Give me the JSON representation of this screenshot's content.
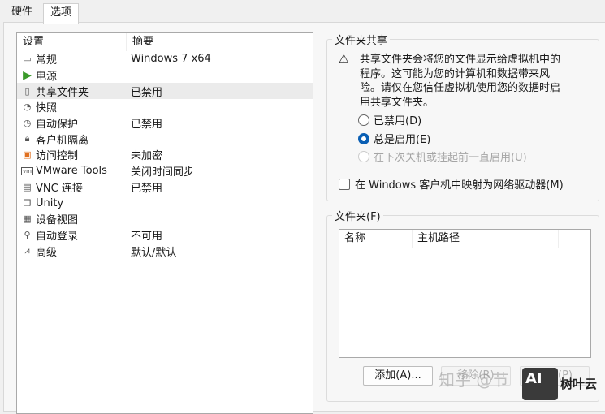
{
  "tabs": [
    {
      "label": "硬件"
    },
    {
      "label": "选项"
    }
  ],
  "settings": {
    "headers": [
      "设置",
      "摘要"
    ],
    "rows": [
      {
        "icon": "monitor-icon",
        "name": "常规",
        "summary": "Windows 7 x64"
      },
      {
        "icon": "play-icon",
        "name": "电源",
        "summary": ""
      },
      {
        "icon": "shared-folder-icon",
        "name": "共享文件夹",
        "summary": "已禁用"
      },
      {
        "icon": "snapshot-icon",
        "name": "快照",
        "summary": ""
      },
      {
        "icon": "clock-icon",
        "name": "自动保护",
        "summary": "已禁用"
      },
      {
        "icon": "lock-icon",
        "name": "客户机隔离",
        "summary": ""
      },
      {
        "icon": "access-control-icon",
        "name": "访问控制",
        "summary": "未加密"
      },
      {
        "icon": "vm-icon",
        "name": "VMware Tools",
        "summary": "关闭时间同步"
      },
      {
        "icon": "vnc-icon",
        "name": "VNC 连接",
        "summary": "已禁用"
      },
      {
        "icon": "unity-icon",
        "name": "Unity",
        "summary": ""
      },
      {
        "icon": "device-view-icon",
        "name": "设备视图",
        "summary": ""
      },
      {
        "icon": "autologin-icon",
        "name": "自动登录",
        "summary": "不可用"
      },
      {
        "icon": "advanced-icon",
        "name": "高级",
        "summary": "默认/默认"
      }
    ]
  },
  "sharing": {
    "title": "文件夹共享",
    "warning": "共享文件夹会将您的文件显示给虚拟机中的程序。这可能为您的计算机和数据带来风险。请仅在您信任虚拟机使用您的数据时启用共享文件夹。",
    "options": [
      {
        "label": "已禁用(D)"
      },
      {
        "label": "总是启用(E)"
      },
      {
        "label": "在下次关机或挂起前一直启用(U)"
      }
    ],
    "map_drive": "在 Windows 客户机中映射为网络驱动器(M)"
  },
  "folders": {
    "title": "文件夹(F)",
    "headers": [
      "名称",
      "主机路径"
    ],
    "buttons": {
      "add": "添加(A)...",
      "remove": "移除(R)",
      "properties": "属性(P)"
    }
  },
  "watermark": {
    "text": "知乎 @节",
    "logo": "AI",
    "brand": "树叶云"
  }
}
